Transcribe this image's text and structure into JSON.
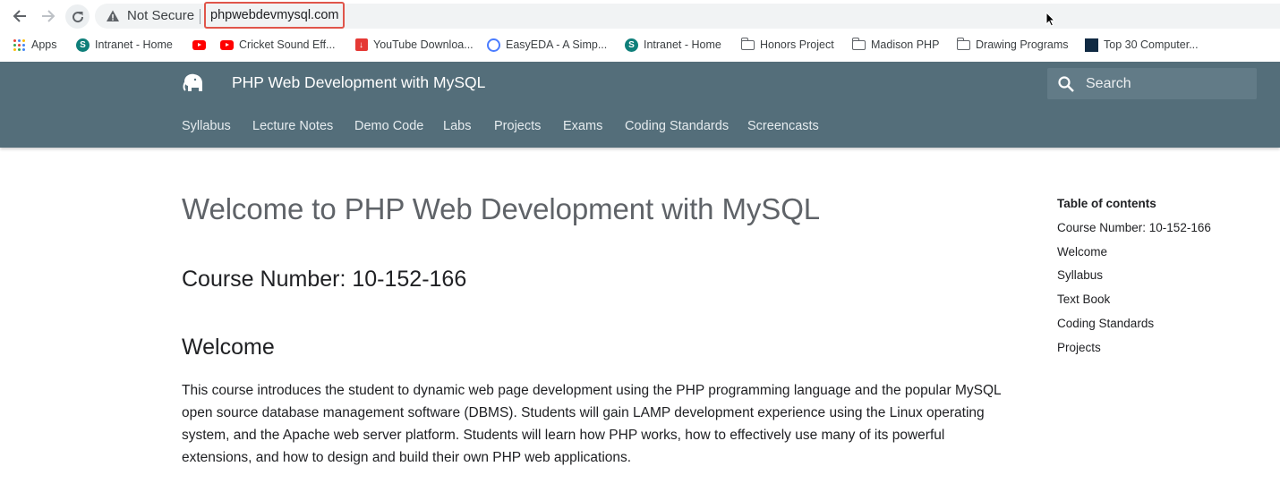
{
  "browser": {
    "security_label": "Not Secure",
    "url": "phpwebdevmysql.com",
    "icons": [
      "arrow-left-icon",
      "arrow-right-icon",
      "reload-icon",
      "warning-icon"
    ]
  },
  "bookmarks": [
    {
      "label": "Apps",
      "icon": "apps-grid-icon"
    },
    {
      "label": "Intranet - Home",
      "icon": "sharepoint-icon"
    },
    {
      "label": "",
      "icon": "youtube-icon"
    },
    {
      "label": "Cricket Sound Eff...",
      "icon": "youtube-icon"
    },
    {
      "label": "YouTube Downloa...",
      "icon": "download-icon"
    },
    {
      "label": "EasyEDA - A Simp...",
      "icon": "easyeda-icon"
    },
    {
      "label": "Intranet - Home",
      "icon": "sharepoint-icon"
    },
    {
      "label": "Honors Project",
      "icon": "folder-icon"
    },
    {
      "label": "Madison PHP",
      "icon": "folder-icon"
    },
    {
      "label": "Drawing Programs",
      "icon": "folder-icon"
    },
    {
      "label": "Top 30 Computer...",
      "icon": "site-icon"
    }
  ],
  "site": {
    "title": "PHP Web Development with MySQL",
    "search_placeholder": "Search",
    "header_color": "#546e7a",
    "tabs": [
      "Syllabus",
      "Lecture Notes",
      "Demo Code",
      "Labs",
      "Projects",
      "Exams",
      "Coding Standards",
      "Screencasts"
    ]
  },
  "main": {
    "page_title": "Welcome to PHP Web Development with MySQL",
    "course_heading": "Course Number: 10-152-166",
    "welcome_heading": "Welcome",
    "welcome_text": "This course introduces the student to dynamic web page development using the PHP programming language and the popular MySQL open source database management software (DBMS). Students will gain LAMP development experience using the Linux operating system, and the Apache web server platform. Students will learn how PHP works, how to effectively use many of its powerful extensions, and how to design and build their own PHP web applications."
  },
  "toc": {
    "title": "Table of contents",
    "items": [
      "Course Number: 10-152-166",
      "Welcome",
      "Syllabus",
      "Text Book",
      "Coding Standards",
      "Projects"
    ]
  }
}
